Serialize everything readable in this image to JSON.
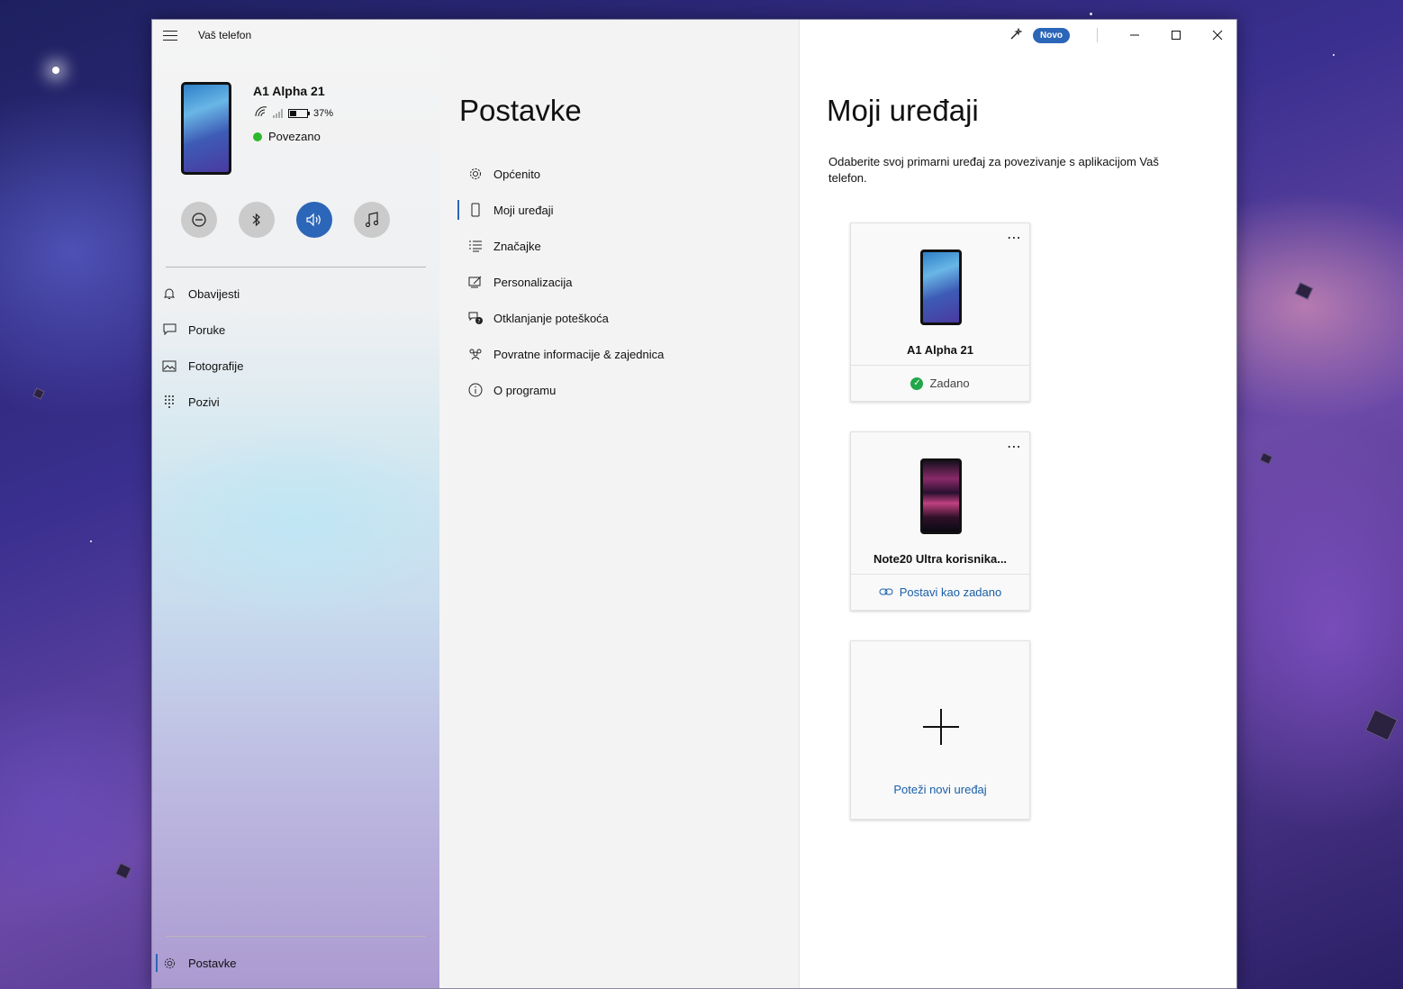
{
  "app": {
    "title": "Vaš telefon"
  },
  "device": {
    "name": "A1 Alpha 21",
    "battery": "37%",
    "battery_level": 0.37,
    "status": "Povezano"
  },
  "quick_actions": [
    {
      "icon": "do-not-disturb-icon"
    },
    {
      "icon": "bluetooth-icon"
    },
    {
      "icon": "volume-icon",
      "active": true
    },
    {
      "icon": "music-note-icon"
    }
  ],
  "nav": {
    "items": [
      {
        "label": "Obavijesti",
        "icon": "bell-icon"
      },
      {
        "label": "Poruke",
        "icon": "chat-icon"
      },
      {
        "label": "Fotografije",
        "icon": "photo-icon"
      },
      {
        "label": "Pozivi",
        "icon": "dialpad-icon"
      }
    ],
    "settings_label": "Postavke"
  },
  "settings": {
    "title": "Postavke",
    "items": [
      {
        "label": "Općenito",
        "icon": "gear-icon"
      },
      {
        "label": "Moji uređaji",
        "icon": "phone-icon",
        "selected": true
      },
      {
        "label": "Značajke",
        "icon": "list-icon"
      },
      {
        "label": "Personalizacija",
        "icon": "brush-icon"
      },
      {
        "label": "Otklanjanje poteškoća",
        "icon": "help-chat-icon"
      },
      {
        "label": "Povratne informacije & zajednica",
        "icon": "people-icon"
      },
      {
        "label": "O programu",
        "icon": "info-icon"
      }
    ]
  },
  "titlebar": {
    "badge": "Novo"
  },
  "my_devices": {
    "title": "Moji uređaji",
    "description": "Odaberite svoj primarni uređaj za povezivanje s aplikacijom Vaš telefon.",
    "devices": [
      {
        "name": "A1 Alpha 21",
        "footer": "Zadano",
        "is_default": true
      },
      {
        "name": "Note20 Ultra korisnika...",
        "footer": "Postavi kao zadano",
        "is_default": false
      }
    ],
    "add_label": "Poteži novi uređaj"
  },
  "colors": {
    "accent": "#2b66b8",
    "connected": "#2eb82e",
    "default_check": "#21a649",
    "link": "#1a5ea8"
  }
}
